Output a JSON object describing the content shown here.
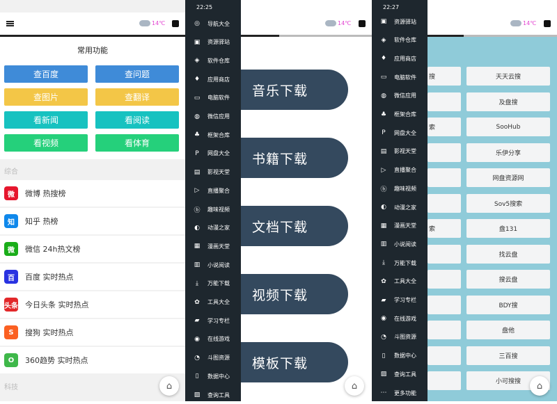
{
  "status_times": {
    "drawer1": "22:25",
    "drawer2": "22:27"
  },
  "weather": {
    "temp": "14℃"
  },
  "panel1": {
    "title": "常用功能",
    "buttons": [
      "查百度",
      "查问题",
      "查图片",
      "查翻译",
      "看新闻",
      "看阅读",
      "看视频",
      "看体育"
    ],
    "section1": "综合",
    "section2": "科技",
    "items": [
      {
        "label": "微博 热搜榜",
        "icon": "weibo-icon",
        "color": "#e6162d",
        "glyph": "微"
      },
      {
        "label": "知乎 热榜",
        "icon": "zhihu-icon",
        "color": "#0f88eb",
        "glyph": "知"
      },
      {
        "label": "微信 24h热文榜",
        "icon": "wechat-icon",
        "color": "#1aad19",
        "glyph": "微"
      },
      {
        "label": "百度 实时热点",
        "icon": "baidu-icon",
        "color": "#2932e1",
        "glyph": "百"
      },
      {
        "label": "今日头条 实时热点",
        "icon": "toutiao-icon",
        "color": "#e2282a",
        "glyph": "头条"
      },
      {
        "label": "搜狗 实时热点",
        "icon": "sogou-icon",
        "color": "#fb6022",
        "glyph": "S"
      },
      {
        "label": "360趋势 实时热点",
        "icon": "360-icon",
        "color": "#3fb84a",
        "glyph": "O"
      }
    ]
  },
  "drawer1": [
    "导航大全",
    "资源驿站",
    "软件仓库",
    "应用商店",
    "电脑软件",
    "微信应用",
    "框架合库",
    "网盘大全",
    "影视天堂",
    "直播聚合",
    "趣味视频",
    "动漫之家",
    "漫画天堂",
    "小说阅读",
    "万能下载",
    "工具大全",
    "学习专栏",
    "在线游戏",
    "斗图资源",
    "数据中心",
    "查询工具"
  ],
  "drawer2": [
    "资源驿站",
    "软件仓库",
    "应用商店",
    "电脑软件",
    "微信应用",
    "框架合库",
    "网盘大全",
    "影视天堂",
    "直播聚合",
    "趣味视频",
    "动漫之家",
    "漫画天堂",
    "小说阅读",
    "万能下载",
    "工具大全",
    "学习专栏",
    "在线游戏",
    "斗图资源",
    "数据中心",
    "查询工具",
    "更多功能"
  ],
  "panel2": {
    "pills": [
      "音乐下载",
      "书籍下载",
      "文档下载",
      "视频下载",
      "模板下载"
    ]
  },
  "panel3": {
    "left_fragments": [
      "搜",
      "",
      "索",
      "",
      "",
      "",
      "索",
      "",
      "",
      "",
      "",
      ""
    ],
    "right": [
      "天天云搜",
      "及盘搜",
      "SooHub",
      "乐伊分享",
      "网盘资源网",
      "Sov5搜索",
      "盘131",
      "找云盘",
      "搜云盘",
      "BDY搜",
      "盘他",
      "三百搜",
      "小可搜搜"
    ]
  }
}
